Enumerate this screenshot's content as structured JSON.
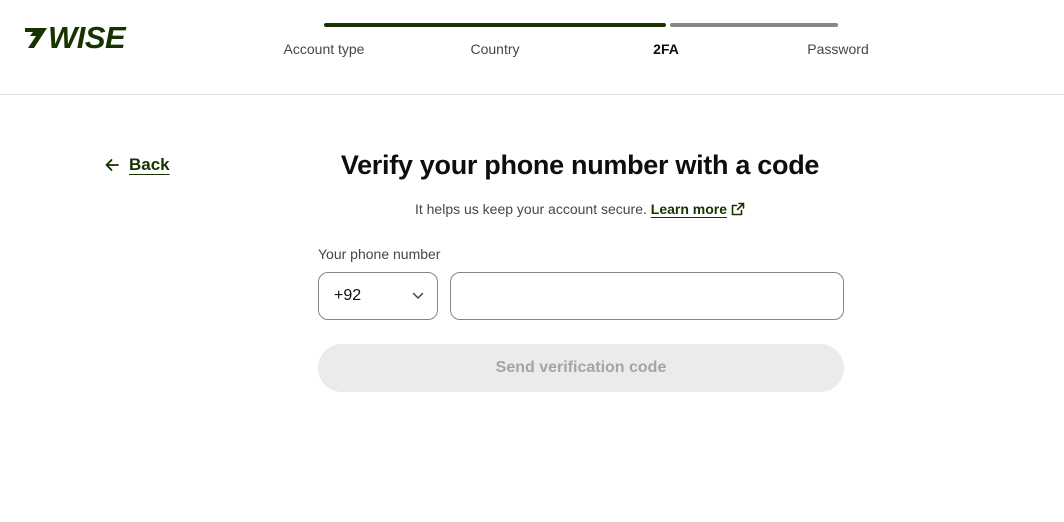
{
  "brand": {
    "logo_text": "WISE",
    "logo_icon": "wise-flag-icon",
    "color": "#163300"
  },
  "stepper": {
    "steps": [
      {
        "label": "Account type",
        "status": "done"
      },
      {
        "label": "Country",
        "status": "done"
      },
      {
        "label": "2FA",
        "status": "current"
      },
      {
        "label": "Password",
        "status": "todo"
      }
    ]
  },
  "nav": {
    "back_label": "Back",
    "back_icon": "arrow-left-icon"
  },
  "main": {
    "title": "Verify your phone number with a code",
    "subtitle": "It helps us keep your account secure.",
    "learn_more": "Learn more",
    "learn_more_icon": "external-link-icon",
    "phone_label": "Your phone number",
    "country_code": "+92",
    "country_code_icon": "chevron-down-icon",
    "phone_value": "",
    "send_button": "Send verification code"
  },
  "colors": {
    "accent": "#163300",
    "progress_todo": "#868685",
    "button_disabled_bg": "#ebebeb",
    "button_disabled_text": "#a4a5a3"
  }
}
